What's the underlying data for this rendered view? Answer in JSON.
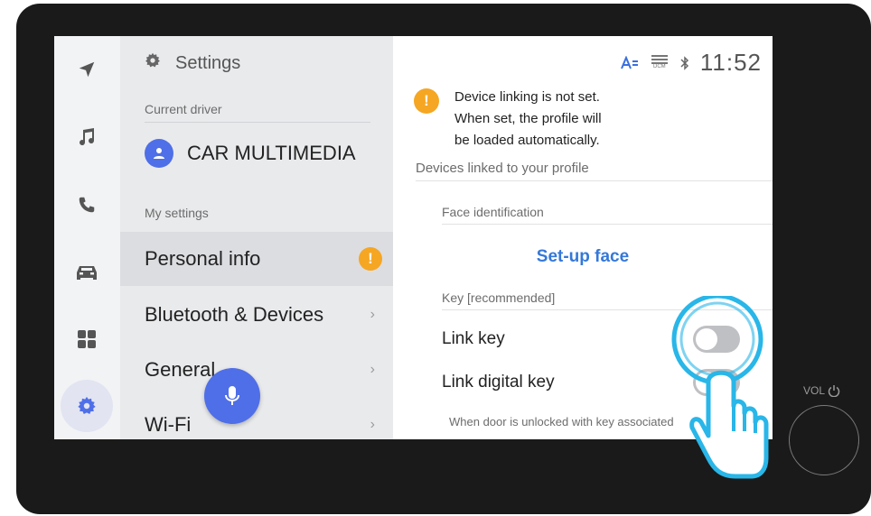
{
  "status_bar": {
    "time": "11:52",
    "icons": [
      "text-size-icon",
      "dcm-icon",
      "bluetooth-icon"
    ],
    "dcm_label": "DCM"
  },
  "rail": {
    "items": [
      "navigation-icon",
      "music-icon",
      "phone-icon",
      "car-icon",
      "apps-icon",
      "settings-icon"
    ],
    "active": "settings-icon"
  },
  "settings_panel": {
    "title": "Settings",
    "current_driver_label": "Current driver",
    "driver_name": "CAR MULTIMEDIA",
    "my_settings_label": "My settings",
    "items": [
      {
        "label": "Personal info",
        "selected": true,
        "badge": "!"
      },
      {
        "label": "Bluetooth & Devices",
        "chevron": "›"
      },
      {
        "label": "General",
        "chevron": "›"
      },
      {
        "label": "Wi-Fi",
        "chevron": "›"
      }
    ]
  },
  "detail": {
    "notice_badge": "!",
    "notice_lines": [
      "Device linking is not set.",
      "When set, the profile will",
      "be loaded automatically."
    ],
    "linked_label": "Devices linked to your profile",
    "face_label": "Face identification",
    "setup_face": "Set-up face",
    "key_label": "Key [recommended]",
    "link_key": {
      "label": "Link key",
      "on": false
    },
    "link_digital_key": {
      "label": "Link digital key",
      "on": false
    },
    "footnote": "When door is unlocked with key associated"
  },
  "hardware": {
    "vol_label": "VOL"
  },
  "colors": {
    "accent": "#4f6fe8",
    "warning": "#f5a623",
    "link": "#3578d8",
    "touch_highlight": "#29b6e8"
  }
}
